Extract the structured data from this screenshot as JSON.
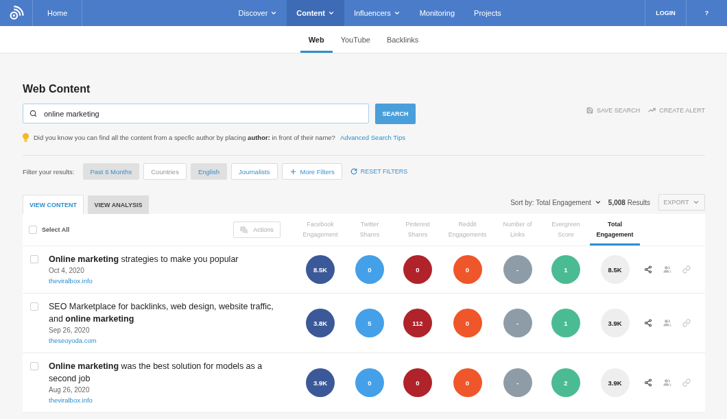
{
  "nav": {
    "left_items": [
      {
        "label": "Home",
        "selected": false,
        "dropdown": false
      }
    ],
    "items": [
      {
        "label": "Discover",
        "selected": false,
        "dropdown": true
      },
      {
        "label": "Content",
        "selected": true,
        "dropdown": true
      },
      {
        "label": "Influencers",
        "selected": false,
        "dropdown": true
      },
      {
        "label": "Monitoring",
        "selected": false,
        "dropdown": false
      },
      {
        "label": "Projects",
        "selected": false,
        "dropdown": false
      }
    ],
    "right_items": [
      {
        "label": "LOGIN",
        "selected": false,
        "dropdown": false
      },
      {
        "label": "?",
        "selected": false,
        "dropdown": false
      }
    ]
  },
  "subnav": {
    "tabs": [
      {
        "label": "Web",
        "selected": true
      },
      {
        "label": "YouTube",
        "selected": false
      },
      {
        "label": "Backlinks",
        "selected": false
      }
    ]
  },
  "page_title": "Web Content",
  "search": {
    "value": "online marketing",
    "button": "SEARCH"
  },
  "search_actions": [
    {
      "kind": "save",
      "label": "SAVE SEARCH",
      "disabled": true
    },
    {
      "kind": "alert",
      "label": "CREATE ALERT",
      "disabled": true
    }
  ],
  "tip": {
    "text": "Did you know you can find all the content from a specfic author by placing **author:** in front of their name?",
    "link": "Advanced Search Tips"
  },
  "filters": {
    "label": "Filter your results:",
    "chips": [
      {
        "kind": "option",
        "label": "Past 6 Months",
        "selected": true,
        "disabled": false
      },
      {
        "kind": "option",
        "label": "Countries",
        "selected": false,
        "disabled": true
      },
      {
        "kind": "option",
        "label": "English",
        "selected": true,
        "disabled": false
      },
      {
        "kind": "option",
        "label": "Journalists",
        "selected": false,
        "disabled": false
      },
      {
        "kind": "more",
        "label": "More Filters",
        "selected": false,
        "disabled": false
      }
    ],
    "reset": "RESET FILTERS"
  },
  "view_tabs": [
    {
      "label": "VIEW CONTENT",
      "selected": true
    },
    {
      "label": "VIEW ANALYSIS",
      "selected": false
    }
  ],
  "sort": {
    "label": "Sort by: Total Engagement"
  },
  "results": "**5,008** Results",
  "export": {
    "label": "EXPORT",
    "disabled": true
  },
  "table": {
    "select_all": {
      "label": "Select All",
      "checked": false
    },
    "actions": {
      "label": "Actions",
      "disabled": true
    },
    "columns": [
      {
        "label": "Facebook\nEngagement",
        "color": "#3b5998",
        "selected": false
      },
      {
        "label": "Twitter\nShares",
        "color": "#44a0e8",
        "selected": false
      },
      {
        "label": "Pinterest\nShares",
        "color": "#b0232a",
        "selected": false
      },
      {
        "label": "Reddit\nEngagements",
        "color": "#ef5629",
        "selected": false
      },
      {
        "label": "Number of\nLinks",
        "color": "#8e9ca7",
        "selected": false
      },
      {
        "label": "Evergreen\nScore",
        "color": "#4bbb93",
        "selected": false
      },
      {
        "label": "Total\nEngagement",
        "color": "#eeeeee",
        "selected": true
      }
    ],
    "rows": [
      {
        "checked": false,
        "title": "**Online marketing** strategies to make you popular",
        "date": "Oct 4, 2020",
        "domain": "theviralbox.info",
        "metrics": [
          "8.5K",
          "0",
          "0",
          "0",
          "-",
          "1",
          "8.5K"
        ]
      },
      {
        "checked": false,
        "title": "SEO Marketplace for backlinks, web design, website traffic, and **online marketing**",
        "date": "Sep 26, 2020",
        "domain": "theseoyoda.com",
        "metrics": [
          "3.8K",
          "5",
          "112",
          "0",
          "-",
          "1",
          "3.9K"
        ]
      },
      {
        "checked": false,
        "title": "**Online marketing** was the best solution for models as a second job",
        "date": "Aug 26, 2020",
        "domain": "theviralbox.info",
        "metrics": [
          "3.9K",
          "0",
          "0",
          "0",
          "-",
          "2",
          "3.9K"
        ]
      }
    ]
  }
}
